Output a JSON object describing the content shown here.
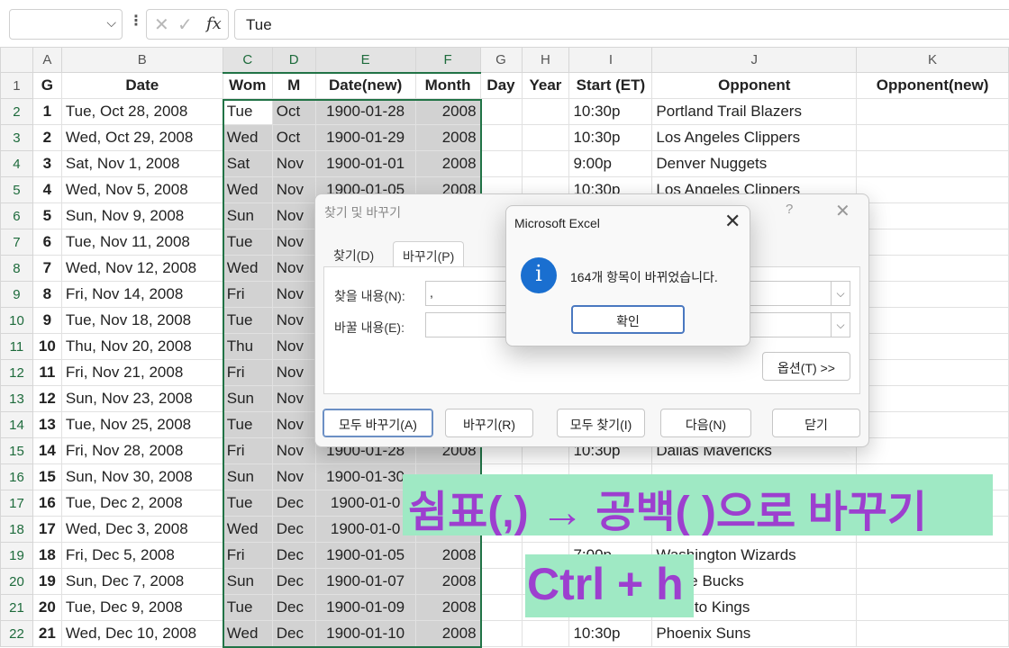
{
  "formula_bar": {
    "name_box": "",
    "fx": "fx",
    "formula": "Tue"
  },
  "columns": [
    "A",
    "B",
    "C",
    "D",
    "E",
    "F",
    "G",
    "H",
    "I",
    "J",
    "K"
  ],
  "header_row": [
    "G",
    "Date",
    "Wom",
    "M",
    "Date(new)",
    "Month",
    "Day",
    "Year",
    "Start (ET)",
    "Opponent",
    "Opponent(new)"
  ],
  "rows": [
    {
      "n": "2",
      "g": "1",
      "date": "Tue, Oct 28, 2008",
      "wom": "Tue",
      "m": "Oct",
      "dnew": "1900-01-28",
      "month": "2008",
      "start": "10:30p",
      "opp": "Portland Trail Blazers"
    },
    {
      "n": "3",
      "g": "2",
      "date": "Wed, Oct 29, 2008",
      "wom": "Wed",
      "m": "Oct",
      "dnew": "1900-01-29",
      "month": "2008",
      "start": "10:30p",
      "opp": "Los Angeles Clippers"
    },
    {
      "n": "4",
      "g": "3",
      "date": "Sat, Nov 1, 2008",
      "wom": "Sat",
      "m": "Nov",
      "dnew": "1900-01-01",
      "month": "2008",
      "start": "9:00p",
      "opp": "Denver Nuggets"
    },
    {
      "n": "5",
      "g": "4",
      "date": "Wed, Nov 5, 2008",
      "wom": "Wed",
      "m": "Nov",
      "dnew": "1900-01-05",
      "month": "2008",
      "start": "10:30p",
      "opp": "Los Angeles Clippers"
    },
    {
      "n": "6",
      "g": "5",
      "date": "Sun, Nov 9, 2008",
      "wom": "Sun",
      "m": "Nov",
      "dnew": "",
      "month": "",
      "start": "",
      "opp": ""
    },
    {
      "n": "7",
      "g": "6",
      "date": "Tue, Nov 11, 2008",
      "wom": "Tue",
      "m": "Nov",
      "dnew": "",
      "month": "",
      "start": "",
      "opp": ""
    },
    {
      "n": "8",
      "g": "7",
      "date": "Wed, Nov 12, 2008",
      "wom": "Wed",
      "m": "Nov",
      "dnew": "",
      "month": "",
      "start": "",
      "opp": ""
    },
    {
      "n": "9",
      "g": "8",
      "date": "Fri, Nov 14, 2008",
      "wom": "Fri",
      "m": "Nov",
      "dnew": "",
      "month": "",
      "start": "",
      "opp": ""
    },
    {
      "n": "10",
      "g": "9",
      "date": "Tue, Nov 18, 2008",
      "wom": "Tue",
      "m": "Nov",
      "dnew": "",
      "month": "",
      "start": "",
      "opp": ""
    },
    {
      "n": "11",
      "g": "10",
      "date": "Thu, Nov 20, 2008",
      "wom": "Thu",
      "m": "Nov",
      "dnew": "",
      "month": "",
      "start": "",
      "opp": ""
    },
    {
      "n": "12",
      "g": "11",
      "date": "Fri, Nov 21, 2008",
      "wom": "Fri",
      "m": "Nov",
      "dnew": "",
      "month": "",
      "start": "",
      "opp": ""
    },
    {
      "n": "13",
      "g": "12",
      "date": "Sun, Nov 23, 2008",
      "wom": "Sun",
      "m": "Nov",
      "dnew": "",
      "month": "",
      "start": "",
      "opp": ""
    },
    {
      "n": "14",
      "g": "13",
      "date": "Tue, Nov 25, 2008",
      "wom": "Tue",
      "m": "Nov",
      "dnew": "",
      "month": "",
      "start": "",
      "opp": ""
    },
    {
      "n": "15",
      "g": "14",
      "date": "Fri, Nov 28, 2008",
      "wom": "Fri",
      "m": "Nov",
      "dnew": "1900-01-28",
      "month": "2008",
      "start": "10:30p",
      "opp": "Dallas Mavericks"
    },
    {
      "n": "16",
      "g": "15",
      "date": "Sun, Nov 30, 2008",
      "wom": "Sun",
      "m": "Nov",
      "dnew": "1900-01-30",
      "month": "",
      "start": "",
      "opp": ""
    },
    {
      "n": "17",
      "g": "16",
      "date": "Tue, Dec 2, 2008",
      "wom": "Tue",
      "m": "Dec",
      "dnew": "1900-01-0",
      "month": "",
      "start": "",
      "opp": ""
    },
    {
      "n": "18",
      "g": "17",
      "date": "Wed, Dec 3, 2008",
      "wom": "Wed",
      "m": "Dec",
      "dnew": "1900-01-0",
      "month": "",
      "start": "",
      "opp": ""
    },
    {
      "n": "19",
      "g": "18",
      "date": "Fri, Dec 5, 2008",
      "wom": "Fri",
      "m": "Dec",
      "dnew": "1900-01-05",
      "month": "2008",
      "start": "7:00p",
      "opp": "Washington Wizards"
    },
    {
      "n": "20",
      "g": "19",
      "date": "Sun, Dec 7, 2008",
      "wom": "Sun",
      "m": "Dec",
      "dnew": "1900-01-07",
      "month": "2008",
      "start": "",
      "opp": "aukee Bucks"
    },
    {
      "n": "21",
      "g": "20",
      "date": "Tue, Dec 9, 2008",
      "wom": "Tue",
      "m": "Dec",
      "dnew": "1900-01-09",
      "month": "2008",
      "start": "",
      "opp": "amento Kings"
    },
    {
      "n": "22",
      "g": "21",
      "date": "Wed, Dec 10, 2008",
      "wom": "Wed",
      "m": "Dec",
      "dnew": "1900-01-10",
      "month": "2008",
      "start": "10:30p",
      "opp": "Phoenix Suns"
    }
  ],
  "find_replace": {
    "title": "찾기 및 바꾸기",
    "help": "?",
    "close": "✕",
    "tab_find": "찾기(D)",
    "tab_replace": "바꾸기(P)",
    "find_label": "찾을 내용(N):",
    "find_value": ",",
    "replace_label": "바꿀 내용(E):",
    "replace_value": "",
    "dropdown_glyph": "⌵",
    "options": "옵션(T) >>",
    "replace_all": "모두 바꾸기(A)",
    "replace": "바꾸기(R)",
    "find_all": "모두 찾기(I)",
    "find_next": "다음(N)",
    "close_btn": "닫기"
  },
  "msgbox": {
    "title": "Microsoft Excel",
    "close": "✕",
    "icon": "i",
    "text": "164개 항목이 바뀌었습니다.",
    "ok": "확인"
  },
  "captions": {
    "line1": "쉼표(,) → 공백( )으로 바꾸기",
    "line2": "Ctrl + h"
  },
  "colors": {
    "excel_green": "#217346",
    "caption_bg": "#9fe9c4",
    "caption_text": "#9d3fcf",
    "selection_fill": "#d2d2d2"
  }
}
